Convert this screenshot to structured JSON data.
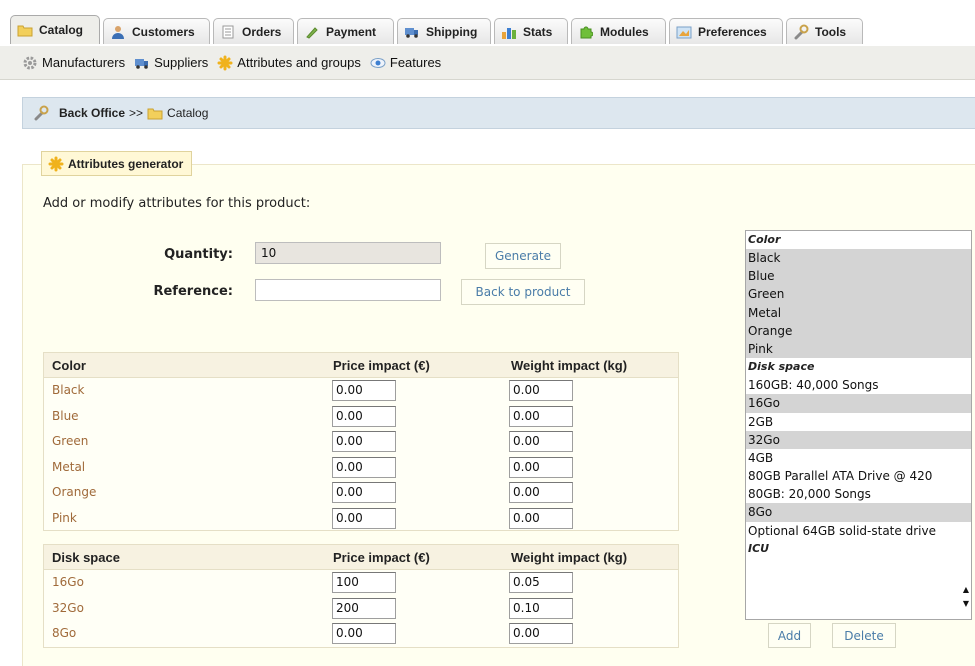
{
  "tabs": [
    {
      "label": "Catalog",
      "icon": "folder-icon",
      "active": true
    },
    {
      "label": "Customers",
      "icon": "user-icon"
    },
    {
      "label": "Orders",
      "icon": "document-icon"
    },
    {
      "label": "Payment",
      "icon": "pen-icon"
    },
    {
      "label": "Shipping",
      "icon": "truck-icon"
    },
    {
      "label": "Stats",
      "icon": "bar-chart-icon"
    },
    {
      "label": "Modules",
      "icon": "puzzle-icon"
    },
    {
      "label": "Preferences",
      "icon": "picture-icon"
    },
    {
      "label": "Tools",
      "icon": "wrench-icon"
    }
  ],
  "submenu": [
    {
      "label": "Manufacturers",
      "icon": "gear-icon"
    },
    {
      "label": "Suppliers",
      "icon": "truck-icon"
    },
    {
      "label": "Attributes and groups",
      "icon": "sparkle-icon"
    },
    {
      "label": "Features",
      "icon": "eye-icon"
    }
  ],
  "breadcrumb": {
    "root": "Back Office",
    "separator": ">>",
    "current": "Catalog"
  },
  "generator": {
    "legend": "Attributes generator",
    "intro": "Add or modify attributes for this product:",
    "quantity_label": "Quantity:",
    "quantity_value": "10",
    "reference_label": "Reference:",
    "reference_value": "",
    "generate_label": "Generate",
    "back_label": "Back to product"
  },
  "tables": [
    {
      "group": "Color",
      "price_header": "Price impact (€)",
      "weight_header": "Weight impact (kg)",
      "rows": [
        {
          "name": "Black",
          "price": "0.00",
          "weight": "0.00"
        },
        {
          "name": "Blue",
          "price": "0.00",
          "weight": "0.00"
        },
        {
          "name": "Green",
          "price": "0.00",
          "weight": "0.00"
        },
        {
          "name": "Metal",
          "price": "0.00",
          "weight": "0.00"
        },
        {
          "name": "Orange",
          "price": "0.00",
          "weight": "0.00"
        },
        {
          "name": "Pink",
          "price": "0.00",
          "weight": "0.00"
        }
      ]
    },
    {
      "group": "Disk space",
      "price_header": "Price impact (€)",
      "weight_header": "Weight impact (kg)",
      "rows": [
        {
          "name": "16Go",
          "price": "100",
          "weight": "0.05"
        },
        {
          "name": "32Go",
          "price": "200",
          "weight": "0.10"
        },
        {
          "name": "8Go",
          "price": "0.00",
          "weight": "0.00"
        }
      ]
    }
  ],
  "listbox": {
    "groups": [
      {
        "label": "Color",
        "options": [
          {
            "label": "Black",
            "selected": true
          },
          {
            "label": "Blue",
            "selected": true
          },
          {
            "label": "Green",
            "selected": true
          },
          {
            "label": "Metal",
            "selected": true
          },
          {
            "label": "Orange",
            "selected": true
          },
          {
            "label": "Pink",
            "selected": true
          }
        ]
      },
      {
        "label": "Disk space",
        "options": [
          {
            "label": "160GB: 40,000 Songs",
            "selected": false
          },
          {
            "label": "16Go",
            "selected": true
          },
          {
            "label": "2GB",
            "selected": false
          },
          {
            "label": "32Go",
            "selected": true
          },
          {
            "label": "4GB",
            "selected": false
          },
          {
            "label": "80GB Parallel ATA Drive @ 420",
            "selected": false
          },
          {
            "label": "80GB: 20,000 Songs",
            "selected": false
          },
          {
            "label": "8Go",
            "selected": true
          },
          {
            "label": "Optional 64GB solid-state drive",
            "selected": false
          }
        ]
      },
      {
        "label": "ICU",
        "options": []
      }
    ],
    "add_label": "Add",
    "delete_label": "Delete"
  },
  "colors": {
    "link": "#4a7ca8",
    "attr_name": "#a06a3a",
    "selected_bg": "#d4d4d4"
  }
}
